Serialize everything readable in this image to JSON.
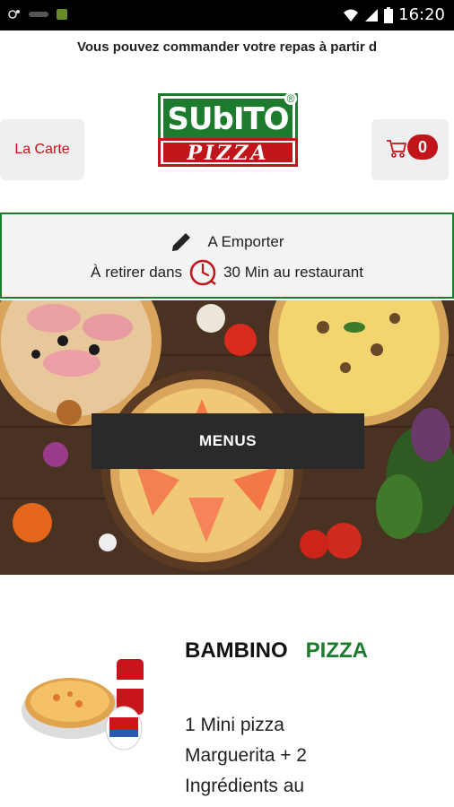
{
  "status_bar": {
    "time": "16:20",
    "left_icons": [
      "camera-icon",
      "app-icon",
      "app-icon"
    ],
    "right_icons": [
      "wifi-icon",
      "signal-icon",
      "battery-icon"
    ]
  },
  "ticker": {
    "text": "Vous pouvez commander votre repas à partir d"
  },
  "header": {
    "carte_label": "La Carte",
    "logo_top": "SUbITO",
    "logo_bottom": "PIZZA",
    "logo_registered": "®",
    "cart_count": "0"
  },
  "mode": {
    "title": "A Emporter",
    "pickup_prefix": "À retirer dans",
    "pickup_time": "30 Min au restaurant"
  },
  "hero": {
    "button_label": "MENUS"
  },
  "product": {
    "title_part1": "BAMBINO",
    "title_part2": "PIZZA",
    "description": "1 Mini pizza Marguerita + 2 Ingrédients au"
  },
  "colors": {
    "brand_red": "#c0151b",
    "brand_green": "#1d7b2e",
    "button_grey": "#efefef"
  }
}
